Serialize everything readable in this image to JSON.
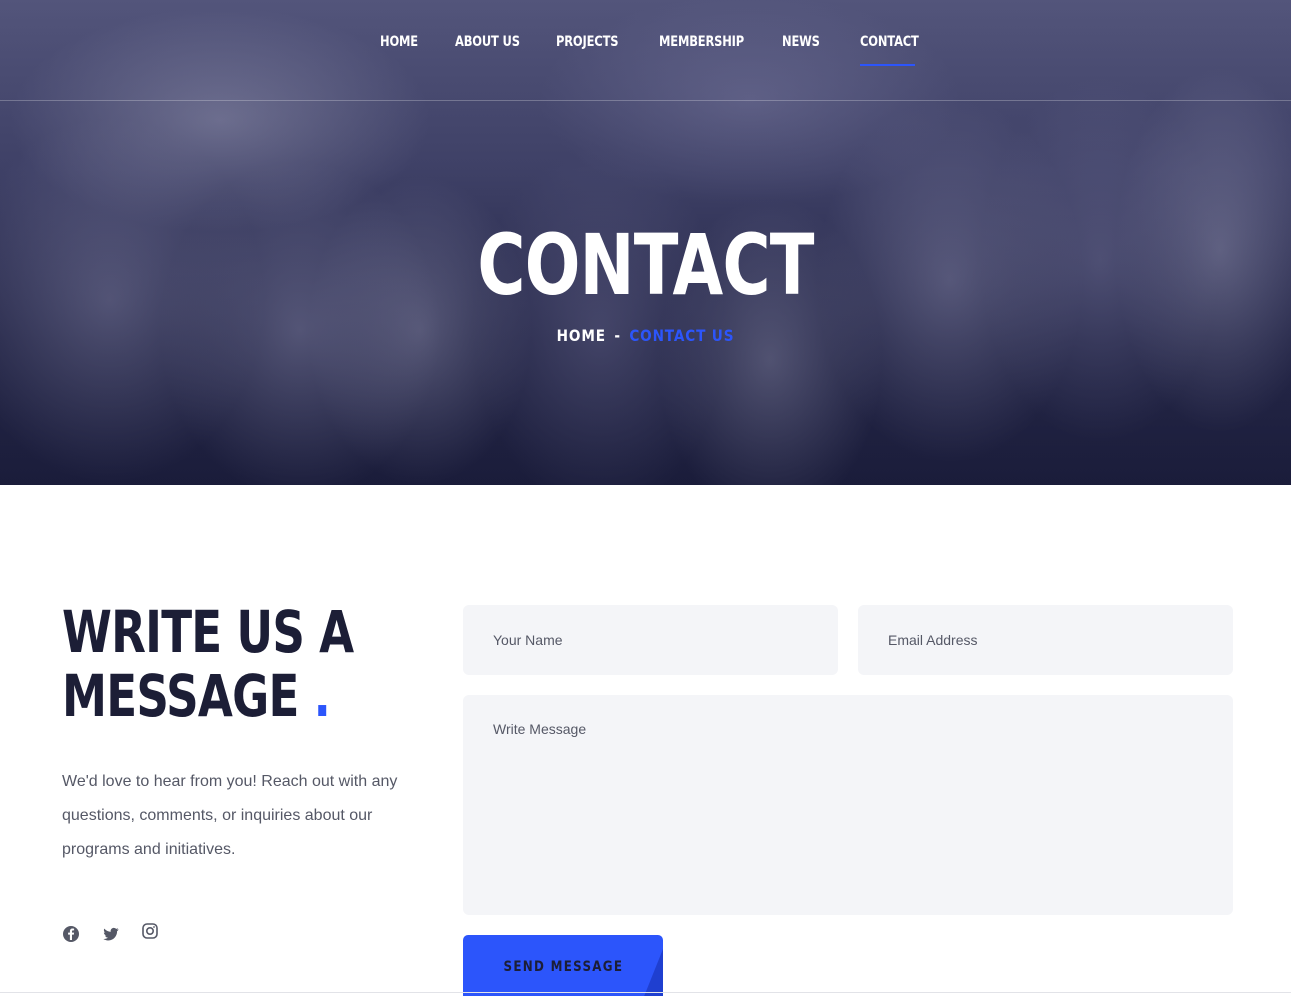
{
  "nav": {
    "items": [
      {
        "label": "HOME"
      },
      {
        "label": "ABOUT US"
      },
      {
        "label": "PROJECTS"
      },
      {
        "label": "MEMBERSHIP"
      },
      {
        "label": "NEWS"
      },
      {
        "label": "CONTACT"
      }
    ],
    "active": "CONTACT"
  },
  "hero": {
    "title": "CONTACT",
    "breadcrumb": {
      "home": "HOME",
      "separator": "-",
      "current": "CONTACT US"
    }
  },
  "contact": {
    "title_line1": "WRITE US A",
    "title_line2": "MESSAGE",
    "title_dot": ".",
    "intro": "We'd love to hear from you! Reach out with any questions, comments, or inquiries about our programs and initiatives.",
    "social": [
      "facebook-icon",
      "twitter-icon",
      "instagram-icon"
    ]
  },
  "form": {
    "name_placeholder": "Your Name",
    "email_placeholder": "Email Address",
    "message_placeholder": "Write Message",
    "submit_label": "SEND MESSAGE"
  },
  "colors": {
    "accent": "#2c55fb",
    "heading": "#1c1e36",
    "text": "#555866",
    "field_bg": "#f4f5f8"
  }
}
